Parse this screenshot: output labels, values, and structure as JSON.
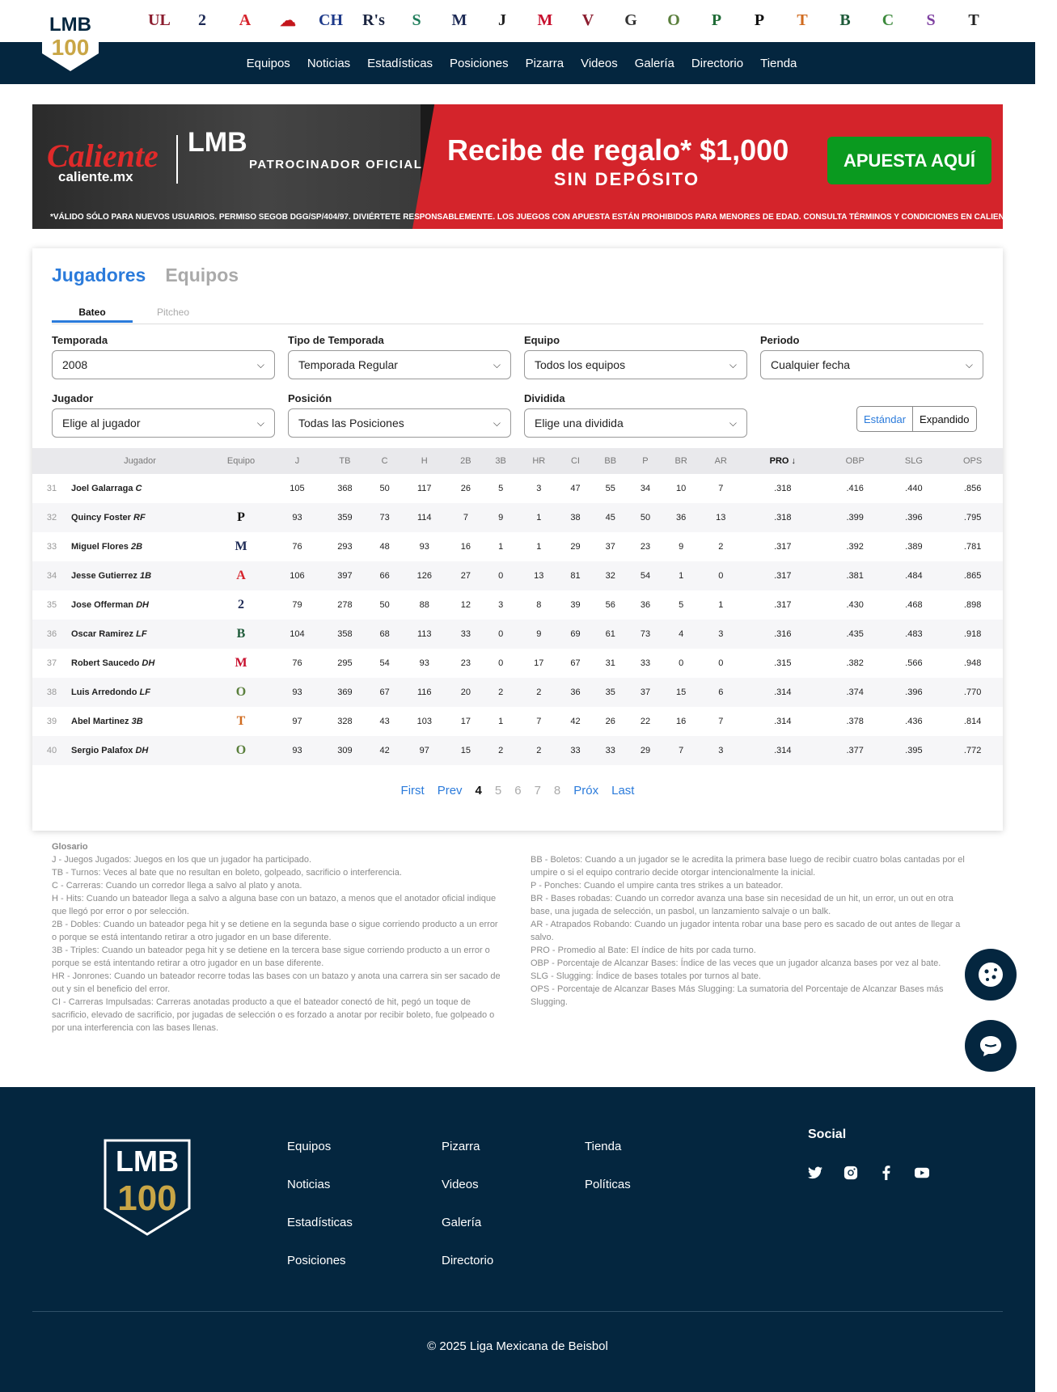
{
  "nav": {
    "items": [
      "Equipos",
      "Noticias",
      "Estadísticas",
      "Posiciones",
      "Pizarra",
      "Videos",
      "Galería",
      "Directorio",
      "Tienda"
    ]
  },
  "team_logos": [
    {
      "name": "union-laguna-logo",
      "glyph": "UL",
      "color": "#8b1c2e"
    },
    {
      "name": "dos-laredos-logo",
      "glyph": "2",
      "color": "#1d2a55"
    },
    {
      "name": "acereros-logo",
      "glyph": "A",
      "color": "#d6222b"
    },
    {
      "name": "el-aguila-logo",
      "glyph": "☁",
      "color": "#c4161c"
    },
    {
      "name": "charros-logo",
      "glyph": "CH",
      "color": "#1e3a8a"
    },
    {
      "name": "rieleros-logo",
      "glyph": "R's",
      "color": "#1a2440"
    },
    {
      "name": "saraperos-logo",
      "glyph": "S",
      "color": "#1f7d5a"
    },
    {
      "name": "yucatan-logo",
      "glyph": "M",
      "color": "#1d2a55"
    },
    {
      "name": "toros-tijuana-logo",
      "glyph": "J",
      "color": "#222222"
    },
    {
      "name": "diablos-logo",
      "glyph": "M",
      "color": "#c8102e"
    },
    {
      "name": "mariachis-logo",
      "glyph": "V",
      "color": "#8b1c2e"
    },
    {
      "name": "generales-logo",
      "glyph": "G",
      "color": "#333333"
    },
    {
      "name": "olmecas-logo",
      "glyph": "O",
      "color": "#5a7f3c"
    },
    {
      "name": "pericos-logo",
      "glyph": "P",
      "color": "#1f6b36"
    },
    {
      "name": "piratas-logo",
      "glyph": "P",
      "color": "#111111"
    },
    {
      "name": "tigres-logo",
      "glyph": "T",
      "color": "#d06b1f"
    },
    {
      "name": "bravos-logo",
      "glyph": "B",
      "color": "#1f5b3a"
    },
    {
      "name": "conspiradores-logo",
      "glyph": "C",
      "color": "#3d8a3d"
    },
    {
      "name": "sultanes-logo",
      "glyph": "S",
      "color": "#7d3fa0"
    },
    {
      "name": "tecolotes-logo",
      "glyph": "T",
      "color": "#222222"
    }
  ],
  "banner": {
    "brand": "Caliente",
    "brand_site": "caliente.mx",
    "league_mark": "LMB",
    "patrocinador": "PATROCINADOR OFICIAL",
    "offer": "Recibe de regalo* $1,000",
    "offer_sub": "SIN DEPÓSITO",
    "cta": "APUESTA AQUÍ",
    "fine_print": "*VÁLIDO SÓLO PARA NUEVOS USUARIOS. PERMISO SEGOB DGG/SP/404/97. DIVIÉRTETE RESPONSABLEMENTE. LOS JUEGOS CON APUESTA ESTÁN PROHIBIDOS PARA MENORES DE EDAD. CONSULTA TÉRMINOS Y CONDICIONES EN CALIENTE.MX"
  },
  "tabs": {
    "players": "Jugadores",
    "teams": "Equipos"
  },
  "subtabs": {
    "batting": "Bateo",
    "pitching": "Pitcheo"
  },
  "filters": {
    "season": {
      "label": "Temporada",
      "value": "2008"
    },
    "season_type": {
      "label": "Tipo de Temporada",
      "value": "Temporada Regular"
    },
    "team": {
      "label": "Equipo",
      "value": "Todos los equipos"
    },
    "period": {
      "label": "Periodo",
      "value": "Cualquier fecha"
    },
    "player": {
      "label": "Jugador",
      "value": "Elige al jugador"
    },
    "position": {
      "label": "Posición",
      "value": "Todas las Posiciones"
    },
    "split": {
      "label": "Dividida",
      "value": "Elige una dividida"
    }
  },
  "view_toggle": {
    "standard": "Estándar",
    "expanded": "Expandido"
  },
  "table": {
    "columns": [
      "",
      "Jugador",
      "Equipo",
      "J",
      "TB",
      "C",
      "H",
      "2B",
      "3B",
      "HR",
      "CI",
      "BB",
      "P",
      "BR",
      "AR",
      "PRO",
      "OBP",
      "SLG",
      "OPS"
    ],
    "sorted_column": "PRO",
    "rows": [
      {
        "rank": "31",
        "name": "Joel Galarraga",
        "pos": "C",
        "team_glyph": "",
        "team_color": "#ffffff",
        "stats": [
          "105",
          "368",
          "50",
          "117",
          "26",
          "5",
          "3",
          "47",
          "55",
          "34",
          "10",
          "7",
          ".318",
          ".416",
          ".440",
          ".856"
        ]
      },
      {
        "rank": "32",
        "name": "Quincy Foster",
        "pos": "RF",
        "team_glyph": "P",
        "team_color": "#111111",
        "stats": [
          "93",
          "359",
          "73",
          "114",
          "7",
          "9",
          "1",
          "38",
          "45",
          "50",
          "36",
          "13",
          ".318",
          ".399",
          ".396",
          ".795"
        ]
      },
      {
        "rank": "33",
        "name": "Miguel Flores",
        "pos": "2B",
        "team_glyph": "M",
        "team_color": "#1d2a55",
        "stats": [
          "76",
          "293",
          "48",
          "93",
          "16",
          "1",
          "1",
          "29",
          "37",
          "23",
          "9",
          "2",
          ".317",
          ".392",
          ".389",
          ".781"
        ]
      },
      {
        "rank": "34",
        "name": "Jesse Gutierrez",
        "pos": "1B",
        "team_glyph": "A",
        "team_color": "#d6222b",
        "stats": [
          "106",
          "397",
          "66",
          "126",
          "27",
          "0",
          "13",
          "81",
          "32",
          "54",
          "1",
          "0",
          ".317",
          ".381",
          ".484",
          ".865"
        ]
      },
      {
        "rank": "35",
        "name": "Jose Offerman",
        "pos": "DH",
        "team_glyph": "2",
        "team_color": "#1d2a55",
        "stats": [
          "79",
          "278",
          "50",
          "88",
          "12",
          "3",
          "8",
          "39",
          "56",
          "36",
          "5",
          "1",
          ".317",
          ".430",
          ".468",
          ".898"
        ]
      },
      {
        "rank": "36",
        "name": "Oscar Ramirez",
        "pos": "LF",
        "team_glyph": "B",
        "team_color": "#1f5b3a",
        "stats": [
          "104",
          "358",
          "68",
          "113",
          "33",
          "0",
          "9",
          "69",
          "61",
          "73",
          "4",
          "3",
          ".316",
          ".435",
          ".483",
          ".918"
        ]
      },
      {
        "rank": "37",
        "name": "Robert Saucedo",
        "pos": "DH",
        "team_glyph": "M",
        "team_color": "#c8102e",
        "stats": [
          "76",
          "295",
          "54",
          "93",
          "23",
          "0",
          "17",
          "67",
          "31",
          "33",
          "0",
          "0",
          ".315",
          ".382",
          ".566",
          ".948"
        ]
      },
      {
        "rank": "38",
        "name": "Luis Arredondo",
        "pos": "LF",
        "team_glyph": "O",
        "team_color": "#5a7f3c",
        "stats": [
          "93",
          "369",
          "67",
          "116",
          "20",
          "2",
          "2",
          "36",
          "35",
          "37",
          "15",
          "6",
          ".314",
          ".374",
          ".396",
          ".770"
        ]
      },
      {
        "rank": "39",
        "name": "Abel Martinez",
        "pos": "3B",
        "team_glyph": "T",
        "team_color": "#d06b1f",
        "stats": [
          "97",
          "328",
          "43",
          "103",
          "17",
          "1",
          "7",
          "42",
          "26",
          "22",
          "16",
          "7",
          ".314",
          ".378",
          ".436",
          ".814"
        ]
      },
      {
        "rank": "40",
        "name": "Sergio Palafox",
        "pos": "DH",
        "team_glyph": "O",
        "team_color": "#5a7f3c",
        "stats": [
          "93",
          "309",
          "42",
          "97",
          "15",
          "2",
          "2",
          "33",
          "33",
          "29",
          "7",
          "3",
          ".314",
          ".377",
          ".395",
          ".772"
        ]
      }
    ]
  },
  "pager": {
    "first": "First",
    "prev": "Prev",
    "current": "4",
    "pages": [
      "5",
      "6",
      "7",
      "8"
    ],
    "next": "Próx",
    "last": "Last"
  },
  "glossary": {
    "title": "Glosario",
    "left": [
      "J - Juegos Jugados: Juegos en los que un jugador ha participado.",
      "TB - Turnos: Veces al bate que no resultan en boleto, golpeado, sacrificio o interferencia.",
      "C - Carreras: Cuando un corredor llega a salvo al plato y anota.",
      "H - Hits: Cuando un bateador llega a salvo a alguna base con un batazo, a menos que el anotador oficial indique que llegó por error o por selección.",
      "2B - Dobles: Cuando un bateador pega hit y se detiene en la segunda base o sigue corriendo producto a un error o porque se está intentando retirar a otro jugador en un base diferente.",
      "3B - Triples: Cuando un bateador pega hit y se detiene en la tercera base sigue corriendo producto a un error o porque se está intentando retirar a otro jugador en un base diferente.",
      "HR - Jonrones: Cuando un bateador recorre todas las bases con un batazo y anota una carrera sin ser sacado de out y sin el beneficio del error.",
      "CI - Carreras Impulsadas: Carreras anotadas producto a que el bateador conectó de hit, pegó un toque de sacrificio, elevado de sacrificio, por jugadas de selección o es forzado a anotar por recibir boleto, fue golpeado o por una interferencia con las bases llenas."
    ],
    "right": [
      "BB - Boletos: Cuando a un jugador se le acredita la primera base luego de recibir cuatro bolas cantadas por el umpire o si el equipo contrario decide otorgar intencionalmente la inicial.",
      "P - Ponches: Cuando el umpire canta tres strikes a un bateador.",
      "BR - Bases robadas: Cuando un corredor avanza una base sin necesidad de un hit, un error, un out en otra base, una jugada de selección, un pasbol, un lanzamiento salvaje o un balk.",
      "AR - Atrapados Robando: Cuando un jugador intenta robar una base pero es sacado de out antes de llegar a salvo.",
      "PRO - Promedio al Bate: El índice de hits por cada turno.",
      "OBP - Porcentaje de Alcanzar Bases: Índice de las veces que un jugador alcanza bases por vez al bate.",
      "SLG - Slugging: Índice de bases totales por turnos al bate.",
      "OPS - Porcentaje de Alcanzar Bases Más Slugging: La sumatoria del Porcentaje de Alcanzar Bases más Slugging."
    ]
  },
  "footer": {
    "logo_text": "LMB",
    "logo_number": "100",
    "col1": [
      "Equipos",
      "Noticias",
      "Estadísticas",
      "Posiciones"
    ],
    "col2": [
      "Pizarra",
      "Videos",
      "Galería",
      "Directorio"
    ],
    "col3": [
      "Tienda",
      "Políticas"
    ],
    "social_title": "Social",
    "social_icons": [
      "twitter-icon",
      "instagram-icon",
      "facebook-icon",
      "youtube-icon"
    ],
    "copyright": "© 2025 Liga Mexicana de Beisbol"
  },
  "colors": {
    "navy": "#04263f",
    "accent": "#2b7bdb",
    "gold": "#c9a646"
  }
}
